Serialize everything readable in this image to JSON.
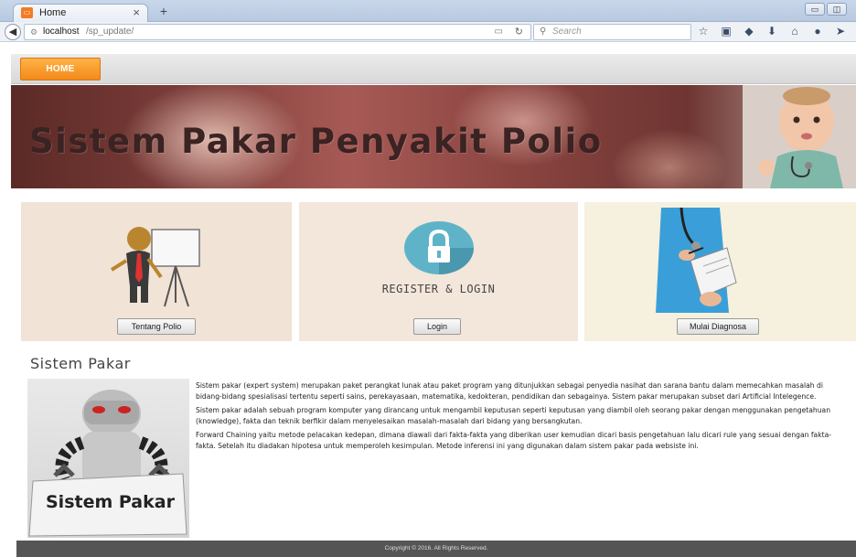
{
  "browser": {
    "tab_title": "Home",
    "tab_close": "×",
    "new_tab": "+",
    "url_host": "localhost",
    "url_path": "/sp_update/",
    "search_placeholder": "Search"
  },
  "nav": {
    "home_label": "HOME"
  },
  "banner": {
    "title": "Sistem Pakar Penyakit Polio"
  },
  "panels": [
    {
      "button": "Tentang Polio"
    },
    {
      "label": "REGISTER & LOGIN",
      "button": "Login"
    },
    {
      "button": "Mulai Diagnosa"
    }
  ],
  "section": {
    "title": "Sistem Pakar",
    "image_caption": "Sistem Pakar",
    "paragraphs": [
      "Sistem pakar (expert system) merupakan paket perangkat lunak atau paket program yang ditunjukkan sebagai penyedia nasihat dan sarana bantu dalam memecahkan masalah di bidang-bidang spesialisasi tertentu seperti sains, perekayasaan, matematika, kedokteran, pendidikan dan sebagainya. Sistem pakar merupakan subset dari Artificial Intelegence.",
      "Sistem pakar adalah sebuah program komputer yang dirancang untuk mengambil keputusan seperti keputusan yang diambil oleh seorang pakar dengan menggunakan pengetahuan (knowledge), fakta dan teknik berfikir dalam menyelesaikan masalah-masalah dari bidang yang bersangkutan.",
      "Forward Chaining yaitu metode pelacakan kedepan, dimana diawali dari fakta-fakta yang diberikan user kemudian dicari basis pengetahuan lalu dicari rule yang sesuai dengan fakta-fakta. Setelah itu diadakan hipotesa untuk memperoleh kesimpulan. Metode inferensi ini yang digunakan dalam sistem pakar pada websiste ini."
    ]
  },
  "footer": {
    "text": "Copyright © 2016. All Rights Reserved."
  }
}
